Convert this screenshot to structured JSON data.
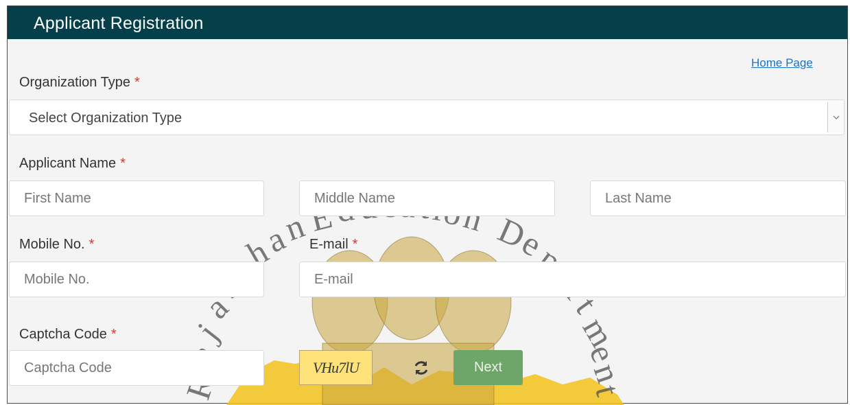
{
  "header": {
    "title": "Applicant Registration"
  },
  "links": {
    "home": "Home Page"
  },
  "required_marker": "*",
  "organization": {
    "label": "Organization Type",
    "selected": "Select Organization Type"
  },
  "applicant_name": {
    "label": "Applicant Name",
    "first_placeholder": "First Name",
    "middle_placeholder": "Middle Name",
    "last_placeholder": "Last Name"
  },
  "mobile": {
    "label": "Mobile No.",
    "placeholder": "Mobile No."
  },
  "email": {
    "label": "E-mail",
    "placeholder": "E-mail"
  },
  "captcha": {
    "label": "Captcha Code",
    "placeholder": "Captcha Code",
    "code": "VHu7lU"
  },
  "buttons": {
    "next": "Next"
  },
  "watermark": {
    "text": "Rajasthan Education Department"
  },
  "colors": {
    "header_bg": "#053f4a",
    "required": "#e0342b",
    "link": "#1a73c8",
    "next_button": "#6ea66a",
    "captcha_bg": "#fde27a"
  }
}
